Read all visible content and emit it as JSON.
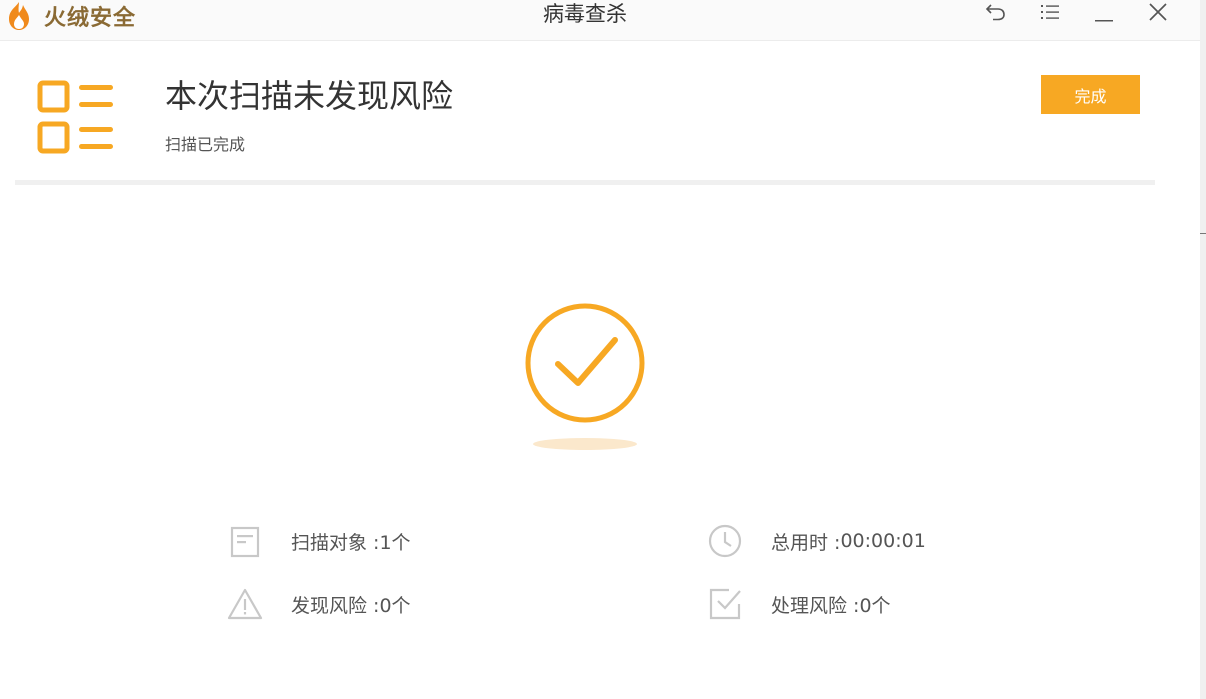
{
  "app": {
    "brand": "火绒安全",
    "window_title": "病毒查杀"
  },
  "icons": {
    "logo": "flame-logo-icon",
    "back": "back-arrow-icon",
    "menu": "menu-list-icon",
    "minimize": "minimize-icon",
    "close": "close-icon",
    "report": "report-list-icon",
    "success": "check-circle-icon",
    "scan_target": "document-icon",
    "duration": "clock-icon",
    "risk": "warning-icon",
    "handled": "checkbox-icon"
  },
  "header": {
    "title": "本次扫描未发现风险",
    "subtitle": "扫描已完成",
    "done_label": "完成"
  },
  "stats": {
    "scanned_label": "扫描对象 : ",
    "scanned_value": "1个",
    "time_label": "总用时 : ",
    "time_value": "00:00:01",
    "found_label": "发现风险 : ",
    "found_value": "0个",
    "handled_label": "处理风险 : ",
    "handled_value": "0个"
  },
  "colors": {
    "accent": "#f7a823",
    "brand_text": "#8a6a34",
    "icon_gray": "#c8c8c8"
  }
}
